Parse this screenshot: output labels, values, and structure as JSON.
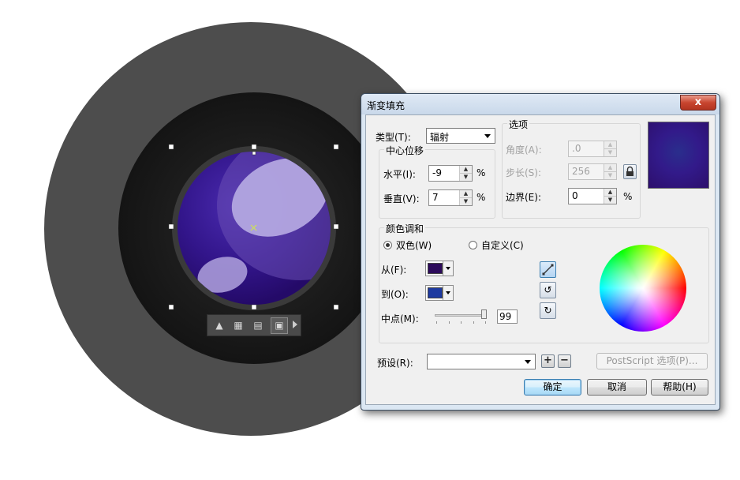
{
  "dialog": {
    "title": "渐变填充",
    "close_glyph": "x",
    "type": {
      "label": "类型(T):",
      "value": "辐射"
    },
    "center_offset": {
      "label": "中心位移",
      "horizontal": {
        "label": "水平(I):",
        "value": "-9",
        "unit": "%"
      },
      "vertical": {
        "label": "垂直(V):",
        "value": "7",
        "unit": "%"
      }
    },
    "options": {
      "label": "选项",
      "angle": {
        "label": "角度(A):",
        "value": ".0"
      },
      "steps": {
        "label": "步长(S):",
        "value": "256"
      },
      "edge": {
        "label": "边界(E):",
        "value": "0",
        "unit": "%"
      }
    },
    "preview_colors": {
      "center": "#2a2e8c",
      "edge": "#2d0f6c"
    },
    "blend": {
      "label": "颜色调和",
      "two_color": {
        "label": "双色(W)",
        "checked": true
      },
      "custom": {
        "label": "自定义(C)",
        "checked": false
      },
      "from": {
        "label": "从(F):",
        "color": "#2c0a5a"
      },
      "to": {
        "label": "到(O):",
        "color": "#1e3aa0"
      },
      "midpoint": {
        "label": "中点(M):",
        "value": "99",
        "fraction": 0.99
      }
    },
    "presets": {
      "label": "预设(R):",
      "value": ""
    },
    "postscript_button": "PostScript 选项(P)...",
    "ok_button": "确定",
    "cancel_button": "取消",
    "help_button": "帮助(H)"
  },
  "canvas": {
    "outer_circle_color": "#4d4d4d",
    "inner_ring_color": "#1c1c1c",
    "sphere_colors": [
      "#3a1aa0",
      "#2b0f78",
      "#5a3b9a"
    ]
  }
}
